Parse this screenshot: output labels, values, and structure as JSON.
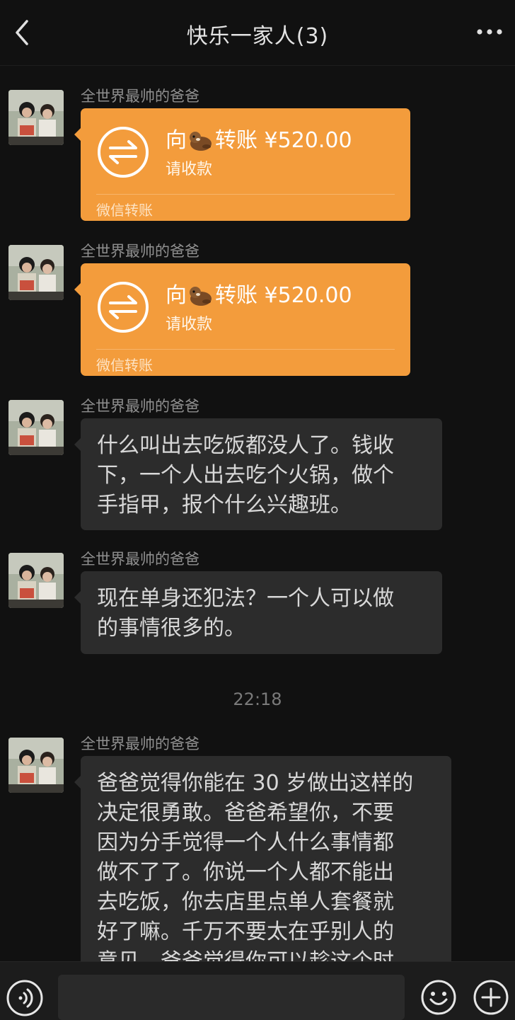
{
  "header": {
    "title": "快乐一家人(3)"
  },
  "messages": [
    {
      "type": "transfer",
      "sender": "全世界最帅的爸爸",
      "prefix": "向",
      "emoji": "otter-emoji",
      "action": "转账",
      "amount": "¥520.00",
      "status": "请收款",
      "footer": "微信转账"
    },
    {
      "type": "transfer",
      "sender": "全世界最帅的爸爸",
      "prefix": "向",
      "emoji": "otter-emoji",
      "action": "转账",
      "amount": "¥520.00",
      "status": "请收款",
      "footer": "微信转账"
    },
    {
      "type": "text",
      "sender": "全世界最帅的爸爸",
      "lines": [
        "什么叫出去吃饭都没人了。钱收",
        "下，一个人出去吃个火锅，做个",
        "手指甲，报个什么兴趣班。"
      ]
    },
    {
      "type": "text",
      "sender": "全世界最帅的爸爸",
      "lines": [
        "现在单身还犯法？一个人可以做",
        "的事情很多的。"
      ]
    },
    {
      "type": "timestamp",
      "text": "22:18"
    },
    {
      "type": "text",
      "sender": "全世界最帅的爸爸",
      "lines": [
        "爸爸觉得你能在 30 岁做出这样的",
        "决定很勇敢。爸爸希望你，不要",
        "因为分手觉得一个人什么事情都",
        "做不了了。你说一个人都不能出",
        "去吃饭，你去店里点单人套餐就",
        "好了嘛。千万不要太在乎别人的",
        "意见。爸爸觉得你可以趁这个时"
      ]
    }
  ],
  "bottom_bar": {
    "input_value": "",
    "icons": [
      "voice-icon",
      "emoji-icon",
      "plus-icon"
    ]
  },
  "colors": {
    "background": "#111111",
    "transfer_card": "#f39c3c",
    "bubble": "#2c2c2c",
    "sender_text": "#8f8f8f"
  }
}
